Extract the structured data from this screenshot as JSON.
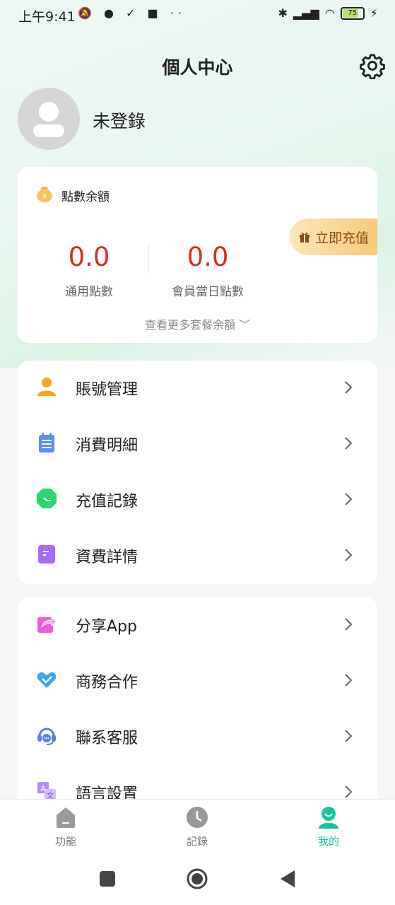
{
  "status_bar": {
    "time": "上午9:41",
    "left_icons": "🔕 ● ✓ ■ ··",
    "battery": "75"
  },
  "header": {
    "title": "個人中心"
  },
  "profile": {
    "name": "未登錄"
  },
  "balance": {
    "title": "點數余額",
    "topup_label": "立即充值",
    "general_points": "0.0",
    "general_points_label": "通用點數",
    "member_daily_points": "0.0",
    "member_daily_points_label": "會員當日點數",
    "more_label": "查看更多套餐余額 ﹀"
  },
  "menu_group_1": [
    {
      "label": "賬號管理",
      "icon": "user-icon",
      "color": "#f5a623"
    },
    {
      "label": "消費明細",
      "icon": "notepad-icon",
      "color": "#5b8def"
    },
    {
      "label": "充值記錄",
      "icon": "clock-icon",
      "color": "#2ed573"
    },
    {
      "label": "資費詳情",
      "icon": "document-icon",
      "color": "#a66cf5"
    }
  ],
  "menu_group_2": [
    {
      "label": "分享App",
      "icon": "share-icon",
      "color": "#f25ad8"
    },
    {
      "label": "商務合作",
      "icon": "handshake-icon",
      "color": "#3aa6f5"
    },
    {
      "label": "聯系客服",
      "icon": "headset-icon",
      "color": "#5b7def"
    },
    {
      "label": "語言設置",
      "icon": "translate-icon",
      "color": "#b48cf5"
    }
  ],
  "tabs": [
    {
      "label": "功能",
      "icon": "home-icon",
      "active": false
    },
    {
      "label": "記錄",
      "icon": "clock-icon",
      "active": false
    },
    {
      "label": "我的",
      "icon": "profile-icon",
      "active": true
    }
  ],
  "colors": {
    "accent": "#19c2a0",
    "value_red": "#d72a2a",
    "topup_text": "#8a4b12"
  }
}
